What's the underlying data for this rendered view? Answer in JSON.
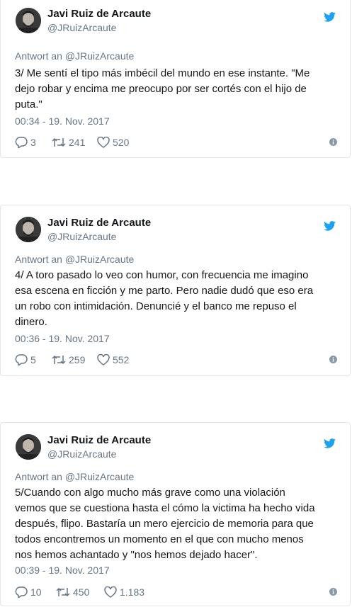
{
  "tweets": [
    {
      "name": "Javi Ruiz de Arcaute",
      "handle": "@JRuizArcaute",
      "reply_to": "Antwort an @JRuizArcaute",
      "lines": [
        "3/ Me sentí el tipo más imbécil del mundo en ese instante. \"Me",
        "dejo robar y encima me preocupo por ser cortés con el hijo de",
        "puta.\""
      ],
      "date": "00:34 - 19. Nov. 2017",
      "replies": "3",
      "retweets": "241",
      "likes": "520"
    },
    {
      "name": "Javi Ruiz de Arcaute",
      "handle": "@JRuizArcaute",
      "reply_to": "Antwort an @JRuizArcaute",
      "lines": [
        "4/ A toro pasado lo veo con humor, con frecuencia me imagino",
        "esa escena en ficción y me parto. Pero nadie dudó que eso era",
        "un robo con intimidación. Denuncié y el banco me repuso el",
        "dinero."
      ],
      "date": "00:36 - 19. Nov. 2017",
      "replies": "5",
      "retweets": "259",
      "likes": "552"
    },
    {
      "name": "Javi Ruiz de Arcaute",
      "handle": "@JRuizArcaute",
      "reply_to": "Antwort an @JRuizArcaute",
      "lines": [
        "5/Cuando con algo mucho más grave como una violación",
        "vemos que se cuestiona hasta el cómo la victima ha hecho vida",
        "después, flipo. Bastaría un mero ejercicio de memoria para que",
        "todos encontremos un momento en el que con mucho menos",
        "nos hemos achantado y \"nos hemos dejado hacer\"."
      ],
      "date": "00:39 - 19. Nov. 2017",
      "replies": "10",
      "retweets": "450",
      "likes": "1.183"
    }
  ],
  "icons": {
    "bird": "twitter-bird-icon",
    "reply": "reply-icon",
    "retweet": "retweet-icon",
    "like": "heart-icon",
    "info": "info-icon"
  },
  "colors": {
    "brand": "#1da1f2",
    "muted": "#657786",
    "border": "#e1e8ed"
  }
}
